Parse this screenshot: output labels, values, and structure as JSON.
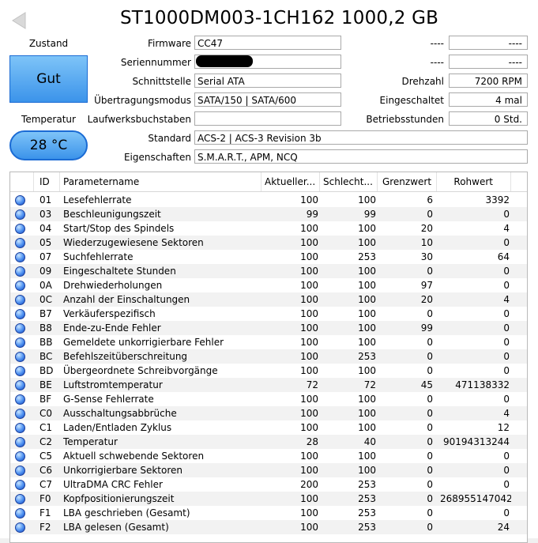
{
  "title": "ST1000DM003-1CH162 1000,2 GB",
  "status": {
    "label": "Zustand",
    "value": "Gut"
  },
  "temperature": {
    "label": "Temperatur",
    "value": "28 °C"
  },
  "info_left": [
    {
      "key": "firmware",
      "label": "Firmware",
      "value": "CC47"
    },
    {
      "key": "serial",
      "label": "Seriennummer",
      "value": ""
    },
    {
      "key": "interface",
      "label": "Schnittstelle",
      "value": "Serial ATA"
    },
    {
      "key": "transfer",
      "label": "Übertragungsmodus",
      "value": "SATA/150 | SATA/600"
    },
    {
      "key": "drive_letters",
      "label": "Laufwerksbuchstaben",
      "value": ""
    }
  ],
  "info_right": [
    {
      "key": "unknown1",
      "label": "----",
      "value": "----"
    },
    {
      "key": "unknown2",
      "label": "----",
      "value": "----"
    },
    {
      "key": "rotation",
      "label": "Drehzahl",
      "value": "7200 RPM"
    },
    {
      "key": "power_count",
      "label": "Eingeschaltet",
      "value": "4 mal"
    },
    {
      "key": "power_hours",
      "label": "Betriebsstunden",
      "value": "0 Std."
    }
  ],
  "standard": {
    "label": "Standard",
    "value": "ACS-2 | ACS-3 Revision 3b"
  },
  "features": {
    "label": "Eigenschaften",
    "value": "S.M.A.R.T., APM, NCQ"
  },
  "table": {
    "columns": [
      "ID",
      "Parametername",
      "Aktueller...",
      "Schlecht...",
      "Grenzwert",
      "Rohwert"
    ],
    "rows": [
      [
        "01",
        "Lesefehlerrate",
        "100",
        "100",
        "6",
        "3392"
      ],
      [
        "03",
        "Beschleunigungszeit",
        "99",
        "99",
        "0",
        "0"
      ],
      [
        "04",
        "Start/Stop des Spindels",
        "100",
        "100",
        "20",
        "4"
      ],
      [
        "05",
        "Wiederzugewiesene Sektoren",
        "100",
        "100",
        "10",
        "0"
      ],
      [
        "07",
        "Suchfehlerrate",
        "100",
        "253",
        "30",
        "64"
      ],
      [
        "09",
        "Eingeschaltete Stunden",
        "100",
        "100",
        "0",
        "0"
      ],
      [
        "0A",
        "Drehwiederholungen",
        "100",
        "100",
        "97",
        "0"
      ],
      [
        "0C",
        "Anzahl der Einschaltungen",
        "100",
        "100",
        "20",
        "4"
      ],
      [
        "B7",
        "Verkäuferspezifisch",
        "100",
        "100",
        "0",
        "0"
      ],
      [
        "B8",
        "Ende-zu-Ende Fehler",
        "100",
        "100",
        "99",
        "0"
      ],
      [
        "BB",
        "Gemeldete unkorrigierbare Fehler",
        "100",
        "100",
        "0",
        "0"
      ],
      [
        "BC",
        "Befehlszeitüberschreitung",
        "100",
        "253",
        "0",
        "0"
      ],
      [
        "BD",
        "Übergeordnete Schreibvorgänge",
        "100",
        "100",
        "0",
        "0"
      ],
      [
        "BE",
        "Luftstromtemperatur",
        "72",
        "72",
        "45",
        "471138332"
      ],
      [
        "BF",
        "G-Sense Fehlerrate",
        "100",
        "100",
        "0",
        "0"
      ],
      [
        "C0",
        "Ausschaltungsabbrüche",
        "100",
        "100",
        "0",
        "4"
      ],
      [
        "C1",
        "Laden/Entladen Zyklus",
        "100",
        "100",
        "0",
        "12"
      ],
      [
        "C2",
        "Temperatur",
        "28",
        "40",
        "0",
        "90194313244"
      ],
      [
        "C5",
        "Aktuell schwebende Sektoren",
        "100",
        "100",
        "0",
        "0"
      ],
      [
        "C6",
        "Unkorrigierbare Sektoren",
        "100",
        "100",
        "0",
        "0"
      ],
      [
        "C7",
        "UltraDMA CRC Fehler",
        "200",
        "253",
        "0",
        "0"
      ],
      [
        "F0",
        "Kopfpositionierungszeit",
        "100",
        "253",
        "0",
        "268955147042..."
      ],
      [
        "F1",
        "LBA geschrieben (Gesamt)",
        "100",
        "253",
        "0",
        "0"
      ],
      [
        "F2",
        "LBA gelesen (Gesamt)",
        "100",
        "253",
        "0",
        "24"
      ]
    ]
  },
  "colors": {
    "good": "#3b93ea",
    "dot": "#4c8ff0"
  }
}
